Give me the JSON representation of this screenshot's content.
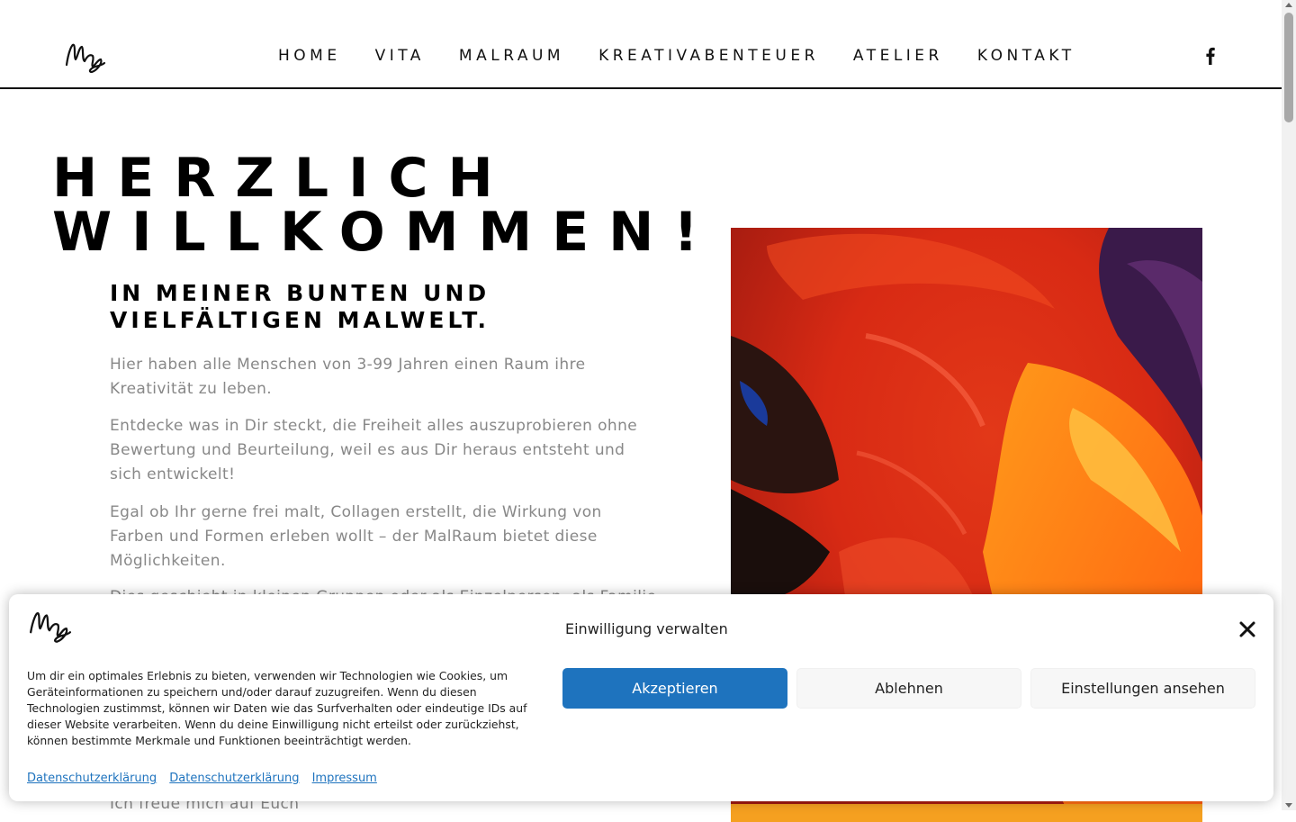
{
  "nav": {
    "items": [
      "HOME",
      "VITA",
      "MALRAUM",
      "KREATIVABENTEUER",
      "ATELIER",
      "KONTAKT"
    ]
  },
  "icons": {
    "logo": "signature-logo-icon",
    "social": "facebook-icon",
    "close": "close-icon"
  },
  "hero": {
    "title_line1": "HERZLICH",
    "title_line2": "WILLKOMMEN!",
    "subtitle_line1": "IN MEINER BUNTEN UND",
    "subtitle_line2": "VIELFÄLTIGEN MALWELT.",
    "paragraphs": [
      "Hier haben alle Menschen von 3-99 Jahren einen Raum  ihre Kreativität zu leben.",
      "Entdecke was in Dir steckt, die Freiheit alles auszuprobieren ohne Bewertung und Beurteilung, weil es aus Dir heraus entsteht und sich entwickelt!",
      "Egal ob Ihr gerne frei malt, Collagen erstellt, die Wirkung von Farben und Formen erleben wollt – der MalRaum bietet diese Möglichkeiten."
    ],
    "partial_paragraph": "Dies geschieht in kleinen Gruppen oder als Einzelperson, als Familie mit",
    "closing": "Ich freue mich auf Euch"
  },
  "consent": {
    "title": "Einwilligung verwalten",
    "text": "Um dir ein optimales Erlebnis zu bieten, verwenden wir Technologien wie Cookies, um Geräteinformationen zu speichern und/oder darauf zuzugreifen. Wenn du diesen Technologien zustimmst, können wir Daten wie das Surfverhalten oder eindeutige IDs auf dieser Website verarbeiten. Wenn du deine Einwilligung nicht erteilst oder zurückziehst, können bestimmte Merkmale und Funktionen beeinträchtigt werden.",
    "accept_label": "Akzeptieren",
    "deny_label": "Ablehnen",
    "settings_label": "Einstellungen ansehen",
    "links": [
      "Datenschutzerklärung",
      "Datenschutzerklärung",
      "Impressum"
    ]
  },
  "colors": {
    "accent": "#1e73be",
    "text_body": "#888888",
    "text_heading": "#000000"
  }
}
